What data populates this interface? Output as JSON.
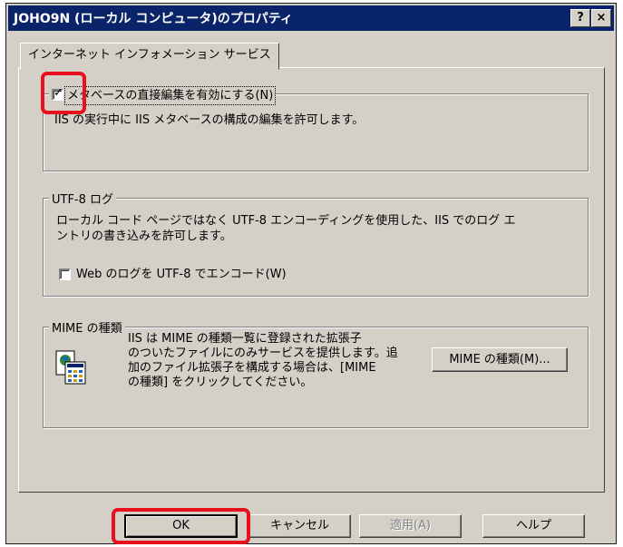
{
  "window": {
    "title": "JOHO9N (ローカル コンピュータ)のプロパティ",
    "help_btn": "?",
    "close_btn": "×"
  },
  "tab": {
    "label": "インターネット インフォメーション サービス"
  },
  "metabase": {
    "checkbox_label": "メタベースの直接編集を有効にする(N)",
    "checked": true,
    "description": "IIS の実行中に IIS メタベースの構成の編集を許可します。"
  },
  "utf8": {
    "group_title": "UTF-8 ログ",
    "description_line1": "ローカル コード ページではなく UTF-8 エンコーディングを使用した、IIS でのログ エ",
    "description_line2": "ントリの書き込みを許可します。",
    "checkbox_label": "Web のログを UTF-8 でエンコード(W)",
    "checked": false
  },
  "mime": {
    "group_title": "MIME の種類",
    "icon": "file-types-icon",
    "description_line1": "IIS は MIME の種類一覧に登録された拡張子",
    "description_line2": "のついたファイルにのみサービスを提供します。追",
    "description_line3": "加のファイル拡張子を構成する場合は、[MIME",
    "description_line4": "の種類] をクリックしてください。",
    "button_label": "MIME の種類(M)..."
  },
  "buttons": {
    "ok": "OK",
    "cancel": "キャンセル",
    "apply": "適用(A)",
    "help": "ヘルプ"
  },
  "colors": {
    "titlebar": "#0a246a",
    "dialog_bg": "#d4d0c8",
    "annotation_red": "#e8101c"
  }
}
